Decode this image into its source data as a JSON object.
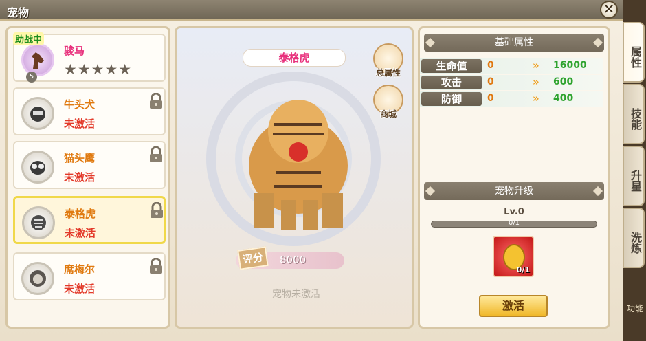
{
  "window": {
    "title": "宠物"
  },
  "pets": [
    {
      "name": "骏马",
      "stars": "★★★★★",
      "level": "5",
      "assist": "助战中",
      "locked": false
    },
    {
      "name": "牛头犬",
      "status": "未激活",
      "locked": true
    },
    {
      "name": "猫头鹰",
      "status": "未激活",
      "locked": true
    },
    {
      "name": "泰格虎",
      "status": "未激活",
      "locked": true,
      "selected": true
    },
    {
      "name": "席梅尔",
      "status": "未激活",
      "locked": true
    }
  ],
  "center": {
    "pet_title": "泰格虎",
    "total_attr_label": "总属性",
    "shop_label": "商城",
    "score_label": "评分",
    "score_value": "8000",
    "inactive_text": "宠物未激活"
  },
  "attributes": {
    "header": "基础属性",
    "rows": [
      {
        "name": "生命值",
        "current": "0",
        "next": "16000"
      },
      {
        "name": "攻击",
        "current": "0",
        "next": "600"
      },
      {
        "name": "防御",
        "current": "0",
        "next": "400"
      }
    ]
  },
  "upgrade": {
    "header": "宠物升级",
    "level": "Lv.0",
    "exp_text": "0/1",
    "exp_fraction": 0,
    "item_count": "0/1",
    "activate_label": "激活"
  },
  "tabs": [
    "属性",
    "技能",
    "升星",
    "洗炼"
  ],
  "edge_text": "功能"
}
